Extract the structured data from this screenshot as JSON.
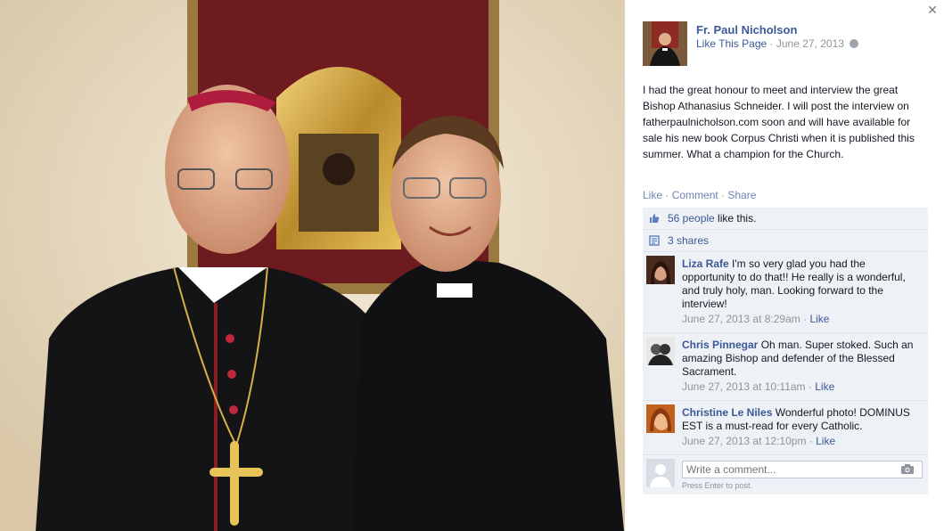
{
  "photo": {
    "description_icon": "photo-icon"
  },
  "header": {
    "page_name": "Fr. Paul Nicholson",
    "like_page": "Like This Page",
    "separator": "·",
    "date": "June 27, 2013",
    "privacy_icon": "globe-icon"
  },
  "post": {
    "text": "I had the great honour to meet and interview the great Bishop Athanasius Schneider. I will post the interview on fatherpaulnicholson.com soon and will have available for sale his new book Corpus Christi when it is published this summer. What a champion for the Church."
  },
  "actions": {
    "like": "Like",
    "comment": "Comment",
    "share": "Share",
    "sep": " · "
  },
  "ufi": {
    "likes_link": "56 people",
    "likes_suffix": " like this.",
    "shares": "3 shares"
  },
  "comments": [
    {
      "name": "Liza Rafe",
      "text": " I'm so very glad you had the opportunity to do that!! He really is a wonderful, and truly holy, man. Looking forward to the interview!",
      "time": "June 27, 2013 at 8:29am",
      "like": "Like"
    },
    {
      "name": "Chris Pinnegar",
      "text": " Oh man. Super stoked. Such an amazing Bishop and defender of the Blessed Sacrament.",
      "time": "June 27, 2013 at 10:11am",
      "like": "Like"
    },
    {
      "name": "Christine Le Niles",
      "text": " Wonderful photo! DOMINUS EST is a must-read for every Catholic.",
      "time": "June 27, 2013 at 12:10pm",
      "like": "Like"
    }
  ],
  "compose": {
    "placeholder": "Write a comment...",
    "hint": "Press Enter to post."
  },
  "colors": {
    "link": "#3b5998",
    "panel_bg": "#eef1f5",
    "muted": "#90949c"
  }
}
